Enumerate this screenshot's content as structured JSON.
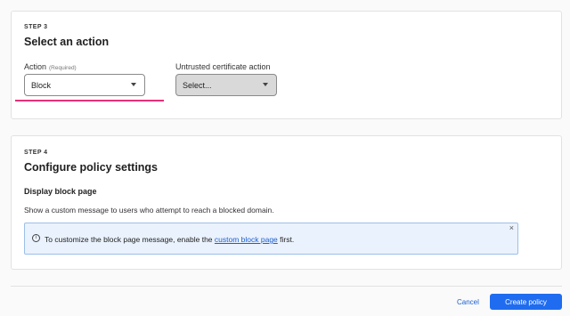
{
  "step3": {
    "step_label": "STEP 3",
    "title": "Select an action",
    "action_label": "Action",
    "action_required": "(Required)",
    "action_value": "Block",
    "untrusted_label": "Untrusted certificate action",
    "untrusted_value": "Select..."
  },
  "step4": {
    "step_label": "STEP 4",
    "title": "Configure policy settings",
    "subheading": "Display block page",
    "description": "Show a custom message to users who attempt to reach a blocked domain.",
    "banner": {
      "info_glyph": "i",
      "text_before": "To customize the block page message, enable the ",
      "link_text": "custom block page",
      "text_after": " first.",
      "close_glyph": "×"
    }
  },
  "footer": {
    "cancel_label": "Cancel",
    "create_label": "Create policy"
  },
  "colors": {
    "accent_blue": "#1f6cf0",
    "focus_underline": "#e8307a",
    "banner_bg": "#eaf2fd"
  }
}
